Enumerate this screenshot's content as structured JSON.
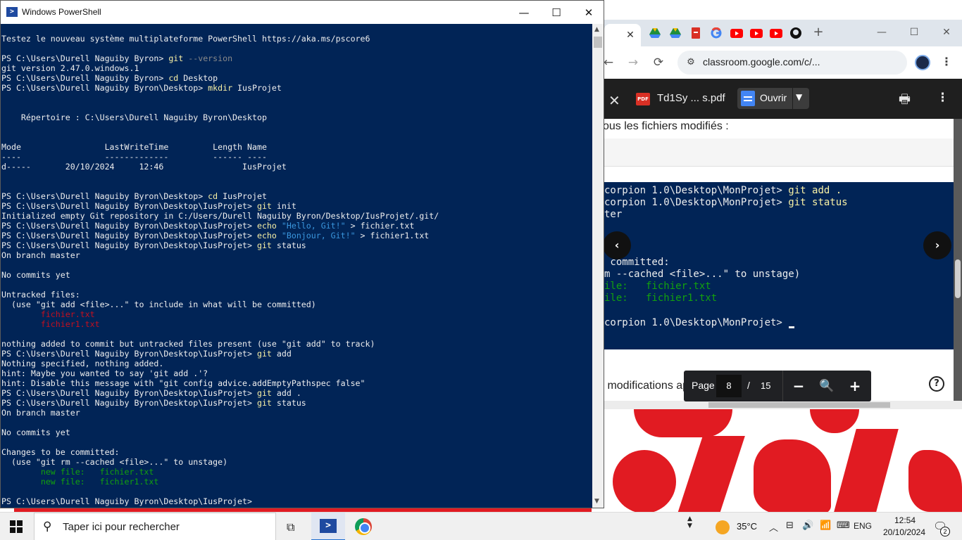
{
  "colors": {
    "ps_bg": "#012456",
    "ps_cmd": "#f9f1a5",
    "ps_string": "#3a96dd",
    "ps_red": "#c50f1f",
    "ps_green": "#13a10e",
    "desktop_red": "#e11b22"
  },
  "powershell": {
    "title": "Windows PowerShell",
    "icon": "powershell-icon",
    "controls": {
      "minimize": "—",
      "maximize": "☐",
      "close": "✕"
    },
    "lines": [
      {
        "segs": [
          {
            "t": "Testez le nouveau système multiplateforme PowerShell https://aka.ms/pscore6"
          }
        ]
      },
      {
        "segs": [
          {
            "t": ""
          }
        ]
      },
      {
        "segs": [
          {
            "t": "PS C:\\Users\\Durell Naguiby Byron> "
          },
          {
            "t": "git",
            "c": "cmd"
          },
          {
            "t": " --version",
            "c": "gray"
          }
        ]
      },
      {
        "segs": [
          {
            "t": "git version 2.47.0.windows.1"
          }
        ]
      },
      {
        "segs": [
          {
            "t": "PS C:\\Users\\Durell Naguiby Byron> "
          },
          {
            "t": "cd",
            "c": "cmd"
          },
          {
            "t": " Desktop"
          }
        ]
      },
      {
        "segs": [
          {
            "t": "PS C:\\Users\\Durell Naguiby Byron\\Desktop> "
          },
          {
            "t": "mkdir",
            "c": "cmd"
          },
          {
            "t": " IusProjet"
          }
        ]
      },
      {
        "segs": [
          {
            "t": ""
          }
        ]
      },
      {
        "segs": [
          {
            "t": ""
          }
        ]
      },
      {
        "segs": [
          {
            "t": "    Répertoire : C:\\Users\\Durell Naguiby Byron\\Desktop"
          }
        ]
      },
      {
        "segs": [
          {
            "t": ""
          }
        ]
      },
      {
        "segs": [
          {
            "t": ""
          }
        ]
      },
      {
        "segs": [
          {
            "t": "Mode                 LastWriteTime         Length Name"
          }
        ]
      },
      {
        "segs": [
          {
            "t": "----                 -------------         ------ ----"
          }
        ]
      },
      {
        "segs": [
          {
            "t": "d-----       20/10/2024     12:46                IusProjet"
          }
        ]
      },
      {
        "segs": [
          {
            "t": ""
          }
        ]
      },
      {
        "segs": [
          {
            "t": ""
          }
        ]
      },
      {
        "segs": [
          {
            "t": "PS C:\\Users\\Durell Naguiby Byron\\Desktop> "
          },
          {
            "t": "cd",
            "c": "cmd"
          },
          {
            "t": " IusProjet"
          }
        ]
      },
      {
        "segs": [
          {
            "t": "PS C:\\Users\\Durell Naguiby Byron\\Desktop\\IusProjet> "
          },
          {
            "t": "git",
            "c": "cmd"
          },
          {
            "t": " init"
          }
        ]
      },
      {
        "segs": [
          {
            "t": "Initialized empty Git repository in C:/Users/Durell Naguiby Byron/Desktop/IusProjet/.git/"
          }
        ]
      },
      {
        "segs": [
          {
            "t": "PS C:\\Users\\Durell Naguiby Byron\\Desktop\\IusProjet> "
          },
          {
            "t": "echo",
            "c": "cmd"
          },
          {
            "t": " "
          },
          {
            "t": "\"Hello, Git!\"",
            "c": "str"
          },
          {
            "t": " > fichier.txt"
          }
        ]
      },
      {
        "segs": [
          {
            "t": "PS C:\\Users\\Durell Naguiby Byron\\Desktop\\IusProjet> "
          },
          {
            "t": "echo",
            "c": "cmd"
          },
          {
            "t": " "
          },
          {
            "t": "\"Bonjour, Git!\"",
            "c": "str"
          },
          {
            "t": " > fichier1.txt"
          }
        ]
      },
      {
        "segs": [
          {
            "t": "PS C:\\Users\\Durell Naguiby Byron\\Desktop\\IusProjet> "
          },
          {
            "t": "git",
            "c": "cmd"
          },
          {
            "t": " status"
          }
        ]
      },
      {
        "segs": [
          {
            "t": "On branch master"
          }
        ]
      },
      {
        "segs": [
          {
            "t": ""
          }
        ]
      },
      {
        "segs": [
          {
            "t": "No commits yet"
          }
        ]
      },
      {
        "segs": [
          {
            "t": ""
          }
        ]
      },
      {
        "segs": [
          {
            "t": "Untracked files:"
          }
        ]
      },
      {
        "segs": [
          {
            "t": "  (use \"git add <file>...\" to include in what will be committed)"
          }
        ]
      },
      {
        "segs": [
          {
            "t": "        fichier.txt",
            "c": "red"
          }
        ]
      },
      {
        "segs": [
          {
            "t": "        fichier1.txt",
            "c": "red"
          }
        ]
      },
      {
        "segs": [
          {
            "t": ""
          }
        ]
      },
      {
        "segs": [
          {
            "t": "nothing added to commit but untracked files present (use \"git add\" to track)"
          }
        ]
      },
      {
        "segs": [
          {
            "t": "PS C:\\Users\\Durell Naguiby Byron\\Desktop\\IusProjet> "
          },
          {
            "t": "git",
            "c": "cmd"
          },
          {
            "t": " add"
          }
        ]
      },
      {
        "segs": [
          {
            "t": "Nothing specified, nothing added."
          }
        ]
      },
      {
        "segs": [
          {
            "t": "hint: Maybe you wanted to say 'git add .'?"
          }
        ]
      },
      {
        "segs": [
          {
            "t": "hint: Disable this message with \"git config advice.addEmptyPathspec false\""
          }
        ]
      },
      {
        "segs": [
          {
            "t": "PS C:\\Users\\Durell Naguiby Byron\\Desktop\\IusProjet> "
          },
          {
            "t": "git",
            "c": "cmd"
          },
          {
            "t": " add ."
          }
        ]
      },
      {
        "segs": [
          {
            "t": "PS C:\\Users\\Durell Naguiby Byron\\Desktop\\IusProjet> "
          },
          {
            "t": "git",
            "c": "cmd"
          },
          {
            "t": " status"
          }
        ]
      },
      {
        "segs": [
          {
            "t": "On branch master"
          }
        ]
      },
      {
        "segs": [
          {
            "t": ""
          }
        ]
      },
      {
        "segs": [
          {
            "t": "No commits yet"
          }
        ]
      },
      {
        "segs": [
          {
            "t": ""
          }
        ]
      },
      {
        "segs": [
          {
            "t": "Changes to be committed:"
          }
        ]
      },
      {
        "segs": [
          {
            "t": "  (use \"git rm --cached <file>...\" to unstage)"
          }
        ]
      },
      {
        "segs": [
          {
            "t": "        new file:   fichier.txt",
            "c": "green"
          }
        ]
      },
      {
        "segs": [
          {
            "t": "        new file:   fichier1.txt",
            "c": "green"
          }
        ]
      },
      {
        "segs": [
          {
            "t": ""
          }
        ]
      },
      {
        "segs": [
          {
            "t": "PS C:\\Users\\Durell Naguiby Byron\\Desktop\\IusProjet> "
          }
        ]
      }
    ]
  },
  "chrome": {
    "tab_close": "✕",
    "tab_favicons": [
      "google-drive-icon",
      "google-drive-icon",
      "pdf-icon",
      "google-icon",
      "youtube-icon",
      "youtube-icon",
      "youtube-icon",
      "github-icon"
    ],
    "new_tab": "+",
    "window_controls": {
      "minimize": "—",
      "maximize": "☐",
      "close": "✕"
    },
    "nav": {
      "back": "←",
      "forward": "→",
      "reload": "⟳"
    },
    "address": "classroom.google.com/c/...",
    "toolbar_icons": [
      "site-info-icon",
      "install-app-icon",
      "translate-icon",
      "bookmark-star-icon"
    ],
    "viewer": {
      "title": "Td1Sy ... s.pdf",
      "pdf_badge": "PDF",
      "open_label": "Ouvrir",
      "page_label": "Page",
      "page_current": "8",
      "page_sep": "/",
      "page_total": "15",
      "zoom_out": "−",
      "zoom_in": "+",
      "page_text_top": "ous les fichiers modifiés :",
      "page_text_bottom": "s modifications ap       s dans l'historique du projet :",
      "help": "?",
      "shot_lines": [
        {
          "t": "corpion 1.0\\Desktop\\MonProjet> ",
          "cmd": "git add ."
        },
        {
          "t": "corpion 1.0\\Desktop\\MonProjet> ",
          "cmd": "git status"
        },
        {
          "t": "ter",
          "cmd": ""
        },
        {
          "t": " committed:",
          "cmd": ""
        },
        {
          "t": "m --cached <file>...\" to unstage)",
          "cmd": ""
        },
        {
          "t": "ile:   fichier.txt",
          "cmd": "",
          "green": true
        },
        {
          "t": "ile:   fichier1.txt",
          "cmd": "",
          "green": true
        },
        {
          "t": "corpion 1.0\\Desktop\\MonProjet> ",
          "cmd": ""
        }
      ]
    }
  },
  "taskbar": {
    "search_placeholder": "Taper ici pour rechercher",
    "weather_temp": "35°C",
    "language": "ENG",
    "time": "12:54",
    "date": "20/10/2024",
    "notification_count": "2"
  }
}
